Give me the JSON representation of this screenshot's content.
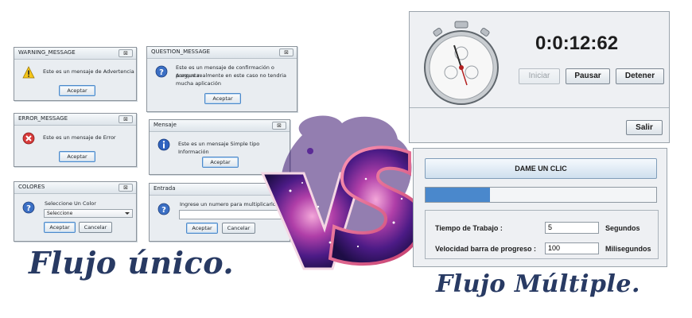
{
  "dialogs": {
    "warning": {
      "title": "WARNING_MESSAGE",
      "message": "Este es un mensaje de Advertencia",
      "ok": "Aceptar",
      "icon": "warning-icon"
    },
    "question": {
      "title": "QUESTION_MESSAGE",
      "line1": "Este es un mensaje de confirmación o pregunta",
      "line2": "Aunque realmente en este caso no tendria",
      "line3": "mucha aplicación",
      "ok": "Aceptar",
      "icon": "question-icon"
    },
    "error": {
      "title": "ERROR_MESSAGE",
      "message": "Este es un mensaje de Error",
      "ok": "Aceptar",
      "icon": "error-icon"
    },
    "info": {
      "title": "Mensaje",
      "message": "Este es un mensaje Simple tipo Información",
      "ok": "Aceptar",
      "icon": "information-icon"
    },
    "colors": {
      "title": "COLORES",
      "message": "Seleccione Un Color",
      "selected": "Seleccione",
      "ok": "Aceptar",
      "cancel": "Cancelar",
      "icon": "question-icon"
    },
    "input": {
      "title": "Entrada",
      "message": "Ingrese un numero para multiplicarlo p",
      "value": "",
      "ok": "Aceptar",
      "cancel": "Cancelar",
      "icon": "question-icon"
    },
    "close_glyph": "⊠"
  },
  "timer": {
    "display": "0:0:12:62",
    "start": "Iniciar",
    "pause": "Pausar",
    "stop": "Detener",
    "exit": "Salir"
  },
  "progress_app": {
    "click_button": "DAME UN CLIC",
    "progress": 0.28,
    "work_time_label": "Tiempo de Trabajo :",
    "work_time_value": "5",
    "work_time_unit": "Segundos",
    "speed_label": "Velocidad barra de progreso :",
    "speed_value": "100",
    "speed_unit": "Milisegundos"
  },
  "captions": {
    "left": "Flujo único.",
    "right": "Flujo Múltiple."
  },
  "colors": {
    "caption": "#283a63",
    "progress_fill": "#4a88cc",
    "vs_purple": "#5a1a8c",
    "vs_pink": "#e0478f"
  }
}
